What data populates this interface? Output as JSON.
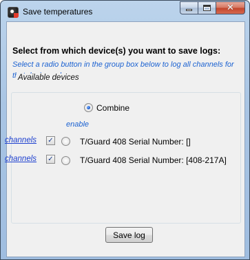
{
  "window": {
    "title": "Save temperatures",
    "close_glyph": "✕"
  },
  "dialog": {
    "heading": "Select from which device(s) you want to save logs:",
    "hint": "Select a radio button in the group box below to log all channels for that device only:"
  },
  "group": {
    "label": "Available devices",
    "combine_label": "Combine",
    "combine_selected": true,
    "enable_label": "enable",
    "devices": [
      {
        "link_label": "channels",
        "enabled": true,
        "selected": false,
        "label": "T/Guard 408 Serial Number: []"
      },
      {
        "link_label": "channels",
        "enabled": true,
        "selected": false,
        "label": "T/Guard 408 Serial Number: [408-217A]"
      }
    ],
    "check_glyph": "✓"
  },
  "actions": {
    "save_label": "Save log"
  },
  "colors": {
    "hint_blue": "#1c62d1",
    "link_blue": "#1c3fcf",
    "close_red": "#c2442b",
    "title_bar": "#bcd4ec",
    "client_bg": "#f0f0f0"
  },
  "icons": [
    "app-icon",
    "minimize-icon",
    "maximize-icon",
    "close-icon",
    "checkmark-icon"
  ]
}
